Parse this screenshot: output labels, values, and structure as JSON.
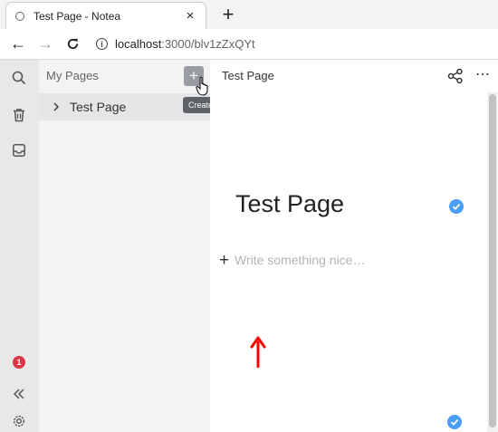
{
  "browser": {
    "tab_title": "Test Page - Notea",
    "tab_close": "×",
    "new_tab": "+",
    "back": "←",
    "forward": "→",
    "reload": "C",
    "info": "i",
    "url_host": "localhost",
    "url_path": ":3000/blv1zZxQYt"
  },
  "sidebar": {
    "header": "My Pages",
    "add_button": "+",
    "tooltip": "Create page cmd+n",
    "items": [
      {
        "label": "Test Page"
      }
    ]
  },
  "rail": {
    "icons": [
      "search-icon",
      "trash-icon",
      "inbox-icon",
      "collapse-icon",
      "settings-icon"
    ],
    "badge_count": "1"
  },
  "main": {
    "topbar_title": "Test Page",
    "page_title": "Test Page",
    "add_block": "+",
    "editor_placeholder": "Write something nice…",
    "more": "⋯"
  },
  "colors": {
    "accent": "#4a9ff5",
    "badge": "#dc3545",
    "annotation": "#ff0000"
  }
}
